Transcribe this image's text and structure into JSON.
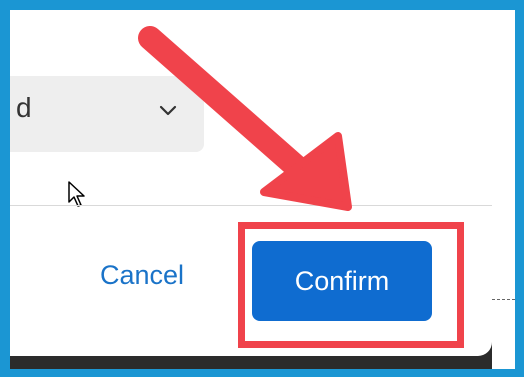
{
  "dialog": {
    "select_value": "d",
    "cancel_label": "Cancel",
    "confirm_label": "Confirm"
  },
  "colors": {
    "outer_border": "#1b96d3",
    "primary_button": "#0f6cd0",
    "link_text": "#1a73c8",
    "annotation_red": "#f0434b"
  },
  "icons": {
    "dropdown": "chevron-down-icon",
    "cursor": "mouse-pointer-icon",
    "annotation": "red-arrow-icon"
  }
}
